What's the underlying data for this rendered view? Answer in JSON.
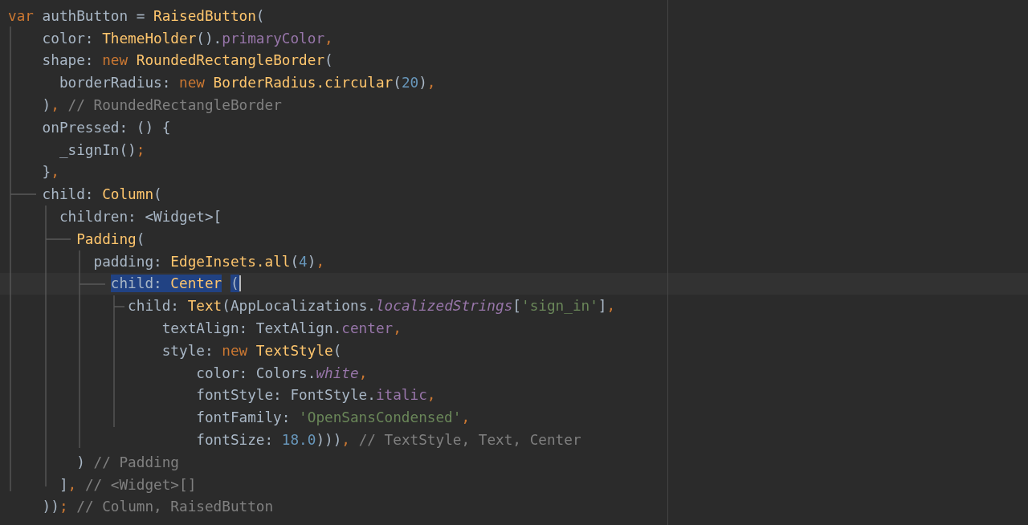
{
  "editor": {
    "lines": [
      {
        "current": false,
        "tokens": [
          {
            "kind": "kw",
            "text": "var "
          },
          {
            "kind": "id",
            "text": "authButton = "
          },
          {
            "kind": "fn",
            "text": "RaisedButton"
          },
          {
            "kind": "id",
            "text": "("
          }
        ]
      },
      {
        "current": false,
        "tokens": [
          {
            "kind": "id",
            "text": "    color: "
          },
          {
            "kind": "fn",
            "text": "ThemeHolder"
          },
          {
            "kind": "id",
            "text": "()."
          },
          {
            "kind": "field",
            "text": "primaryColor"
          },
          {
            "kind": "punc",
            "text": ","
          }
        ]
      },
      {
        "current": false,
        "tokens": [
          {
            "kind": "id",
            "text": "    shape: "
          },
          {
            "kind": "kw",
            "text": "new "
          },
          {
            "kind": "fn",
            "text": "RoundedRectangleBorder"
          },
          {
            "kind": "id",
            "text": "("
          }
        ]
      },
      {
        "current": false,
        "tokens": [
          {
            "kind": "id",
            "text": "      borderRadius: "
          },
          {
            "kind": "kw",
            "text": "new "
          },
          {
            "kind": "fn",
            "text": "BorderRadius.circular"
          },
          {
            "kind": "id",
            "text": "("
          },
          {
            "kind": "num",
            "text": "20"
          },
          {
            "kind": "id",
            "text": ")"
          },
          {
            "kind": "punc",
            "text": ","
          }
        ]
      },
      {
        "current": false,
        "tokens": [
          {
            "kind": "id",
            "text": "    )"
          },
          {
            "kind": "punc",
            "text": ","
          },
          {
            "kind": "cmt",
            "text": " // RoundedRectangleBorder"
          }
        ]
      },
      {
        "current": false,
        "tokens": [
          {
            "kind": "id",
            "text": "    onPressed: () {"
          }
        ]
      },
      {
        "current": false,
        "tokens": [
          {
            "kind": "id",
            "text": "      _signIn()"
          },
          {
            "kind": "punc",
            "text": ";"
          }
        ]
      },
      {
        "current": false,
        "tokens": [
          {
            "kind": "id",
            "text": "    }"
          },
          {
            "kind": "punc",
            "text": ","
          }
        ]
      },
      {
        "current": false,
        "tokens": [
          {
            "kind": "id",
            "text": "    child: "
          },
          {
            "kind": "fn",
            "text": "Column"
          },
          {
            "kind": "id",
            "text": "("
          }
        ]
      },
      {
        "current": false,
        "tokens": [
          {
            "kind": "id",
            "text": "      children: <Widget>["
          }
        ]
      },
      {
        "current": false,
        "tokens": [
          {
            "kind": "fn",
            "text": "        Padding"
          },
          {
            "kind": "id",
            "text": "("
          }
        ]
      },
      {
        "current": false,
        "tokens": [
          {
            "kind": "id",
            "text": "          padding: "
          },
          {
            "kind": "fn",
            "text": "EdgeInsets.all"
          },
          {
            "kind": "id",
            "text": "("
          },
          {
            "kind": "num",
            "text": "4"
          },
          {
            "kind": "id",
            "text": ")"
          },
          {
            "kind": "punc",
            "text": ","
          }
        ]
      },
      {
        "current": true,
        "tokens": [
          {
            "kind": "id",
            "text": "            child: ",
            "selected": true
          },
          {
            "kind": "fn",
            "text": "Center",
            "selected": true
          },
          {
            "kind": "id",
            "text": " (",
            "selected": true
          }
        ]
      },
      {
        "current": false,
        "tokens": [
          {
            "kind": "id",
            "text": "              child: "
          },
          {
            "kind": "fn",
            "text": "Text"
          },
          {
            "kind": "id",
            "text": "(AppLocalizations."
          },
          {
            "kind": "static",
            "text": "localizedStrings"
          },
          {
            "kind": "id",
            "text": "["
          },
          {
            "kind": "str",
            "text": "'sign_in'"
          },
          {
            "kind": "id",
            "text": "]"
          },
          {
            "kind": "punc",
            "text": ","
          }
        ]
      },
      {
        "current": false,
        "tokens": [
          {
            "kind": "id",
            "text": "                  textAlign: TextAlign."
          },
          {
            "kind": "field",
            "text": "center"
          },
          {
            "kind": "punc",
            "text": ","
          }
        ]
      },
      {
        "current": false,
        "tokens": [
          {
            "kind": "id",
            "text": "                  style: "
          },
          {
            "kind": "kw",
            "text": "new "
          },
          {
            "kind": "fn",
            "text": "TextStyle"
          },
          {
            "kind": "id",
            "text": "("
          }
        ]
      },
      {
        "current": false,
        "tokens": [
          {
            "kind": "id",
            "text": "                      color: Colors."
          },
          {
            "kind": "static",
            "text": "white"
          },
          {
            "kind": "punc",
            "text": ","
          }
        ]
      },
      {
        "current": false,
        "tokens": [
          {
            "kind": "id",
            "text": "                      fontStyle: FontStyle."
          },
          {
            "kind": "field",
            "text": "italic"
          },
          {
            "kind": "punc",
            "text": ","
          }
        ]
      },
      {
        "current": false,
        "tokens": [
          {
            "kind": "id",
            "text": "                      fontFamily: "
          },
          {
            "kind": "str",
            "text": "'OpenSansCondensed'"
          },
          {
            "kind": "punc",
            "text": ","
          }
        ]
      },
      {
        "current": false,
        "tokens": [
          {
            "kind": "id",
            "text": "                      fontSize: "
          },
          {
            "kind": "num",
            "text": "18.0"
          },
          {
            "kind": "id",
            "text": ")))"
          },
          {
            "kind": "punc",
            "text": ","
          },
          {
            "kind": "cmt",
            "text": " // TextStyle, Text, Center"
          }
        ]
      },
      {
        "current": false,
        "tokens": [
          {
            "kind": "id",
            "text": "        )"
          },
          {
            "kind": "cmt",
            "text": " // Padding"
          }
        ]
      },
      {
        "current": false,
        "tokens": [
          {
            "kind": "id",
            "text": "      ]"
          },
          {
            "kind": "punc",
            "text": ","
          },
          {
            "kind": "cmt",
            "text": " // <Widget>[]"
          }
        ]
      },
      {
        "current": false,
        "tokens": [
          {
            "kind": "id",
            "text": "    ))"
          },
          {
            "kind": "punc",
            "text": ";"
          },
          {
            "kind": "cmt",
            "text": " // Column, RaisedButton"
          }
        ]
      }
    ]
  }
}
